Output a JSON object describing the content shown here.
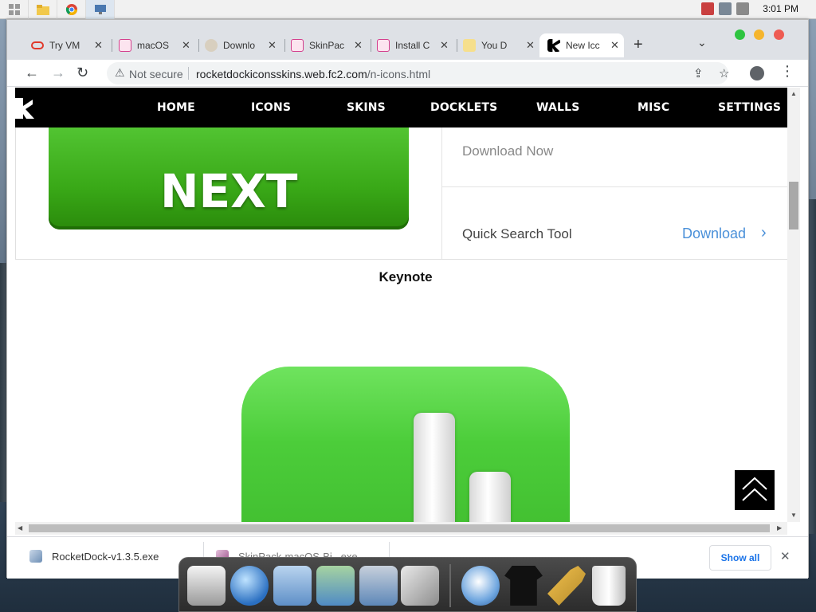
{
  "taskbar": {
    "clock": "3:01 PM",
    "apps": [
      "start-icon",
      "file-explorer-icon",
      "chrome-icon",
      "remote-desktop-icon"
    ]
  },
  "browser": {
    "tabs": [
      {
        "title": "Try VM",
        "icon": "oracle-icon",
        "color": "#e0392b"
      },
      {
        "title": "macOS",
        "icon": "skinpack-icon",
        "color": "#d43f8d"
      },
      {
        "title": "Downlo",
        "icon": "download-site-icon",
        "color": "#9b8b6a"
      },
      {
        "title": "SkinPac",
        "icon": "skinpack-icon",
        "color": "#d43f8d"
      },
      {
        "title": "Install C",
        "icon": "skinpack-icon",
        "color": "#d43f8d"
      },
      {
        "title": "You D",
        "icon": "check-icon",
        "color": "#e8b31c"
      },
      {
        "title": "New Icc",
        "icon": "rocketdock-icon",
        "color": "#000000",
        "active": true
      }
    ],
    "new_tab": "+",
    "omnibox": {
      "security_label": "Not secure",
      "url_domain": "rocketdockiconsskins.web.fc2.com",
      "url_path": "/n-icons.html"
    }
  },
  "site": {
    "nav": [
      "HOME",
      "ICONS",
      "SKINS",
      "DOCKLETS",
      "WALLS",
      "MISC",
      "SETTINGS"
    ],
    "banner_text": "NEXT",
    "ad": {
      "download_now": "Download Now",
      "quick_search": "Quick Search Tool",
      "download_link": "Download"
    },
    "section_title": "Keynote"
  },
  "downloads": {
    "item1": "RocketDock-v1.3.5.exe",
    "item2": "SkinPack-macOS-Bi...exe",
    "show_all": "Show all"
  },
  "dock": {
    "items": [
      "finder-icon",
      "internet-icon",
      "documents-folder-icon",
      "music-folder-icon",
      "pictures-folder-icon",
      "xcode-tools-icon",
      "safari-icon",
      "tshirt-icon",
      "hammer-icon",
      "recycle-bin-icon"
    ]
  },
  "colors": {
    "accent_blue": "#4a90d9",
    "banner_green": "#39a817",
    "keynote_green": "#4ccd3a"
  }
}
